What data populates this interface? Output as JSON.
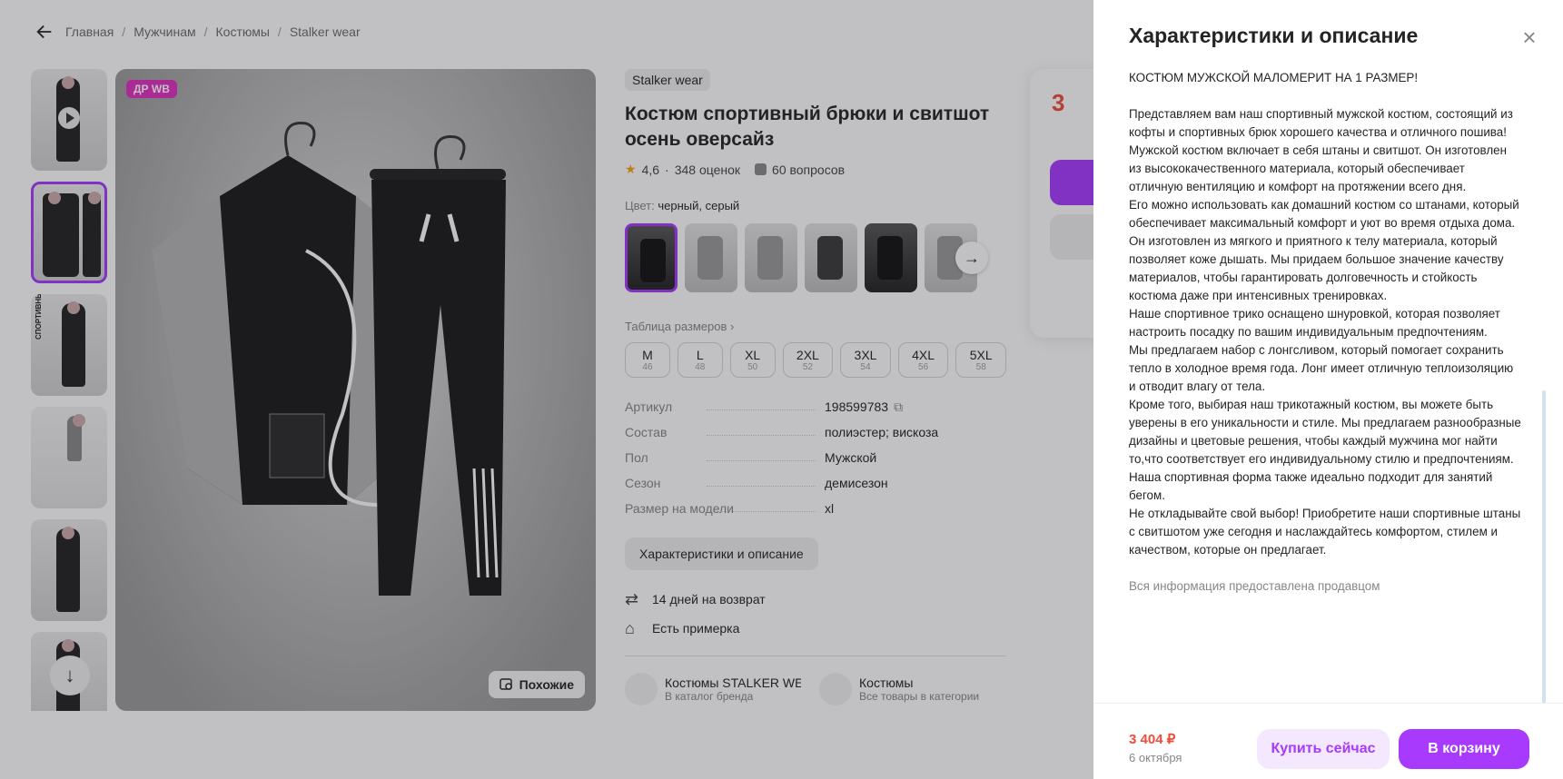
{
  "breadcrumb": {
    "items": [
      "Главная",
      "Мужчинам",
      "Костюмы",
      "Stalker wear"
    ]
  },
  "gallery": {
    "thumb_text": "СПОРТИВНЫЙ КОСТЮМ",
    "badge": "ДР WB",
    "similar_label": "Похожие"
  },
  "product": {
    "brand": "Stalker wear",
    "title": "Костюм спортивный брюки и свитшот осень оверсайз",
    "rating": "4,6",
    "reviews": "348 оценок",
    "questions": "60 вопросов",
    "color_label": "Цвет:",
    "color_value": "черный, серый",
    "size_table_link": "Таблица размеров",
    "sizes": [
      {
        "name": "M",
        "ru": "46"
      },
      {
        "name": "L",
        "ru": "48"
      },
      {
        "name": "XL",
        "ru": "50"
      },
      {
        "name": "2XL",
        "ru": "52"
      },
      {
        "name": "3XL",
        "ru": "54"
      },
      {
        "name": "4XL",
        "ru": "56"
      },
      {
        "name": "5XL",
        "ru": "58"
      }
    ],
    "specs": [
      {
        "k": "Артикул",
        "v": "198599783"
      },
      {
        "k": "Состав",
        "v": "полиэстер; вискоза"
      },
      {
        "k": "Пол",
        "v": "Мужской"
      },
      {
        "k": "Сезон",
        "v": "демисезон"
      },
      {
        "k": "Размер на модели",
        "v": "xl"
      }
    ],
    "desc_button": "Характеристики и описание",
    "return": "14 дней на возврат",
    "fitting": "Есть примерка",
    "card1_title": "Костюмы STALKER WEAR",
    "card1_sub": "В каталог бренда",
    "card2_title": "Костюмы",
    "card2_sub": "Все товары в категории"
  },
  "pricebox": {
    "price_partial": "3"
  },
  "panel": {
    "title": "Характеристики и описание",
    "description": "КОСТЮМ МУЖСКОЙ МАЛОМЕРИТ НА 1 РАЗМЕР!\n\nПредставляем вам наш спортивный мужской костюм, состоящий из кофты и спортивных брюк хорошего качества и отличного пошива!\nМужской костюм включает в себя штаны и свитшот. Он изготовлен из высококачественного материала, который обеспечивает отличную вентиляцию и комфорт на протяжении всего дня.\nЕго можно использовать как домашний костюм со штанами, который обеспечивает максимальный комфорт и уют во время отдыха дома. Он изготовлен из мягкого и приятного к телу материала, который позволяет коже дышать. Мы придаем большое значение качеству материалов, чтобы гарантировать долговечность и стойкость костюма даже при интенсивных тренировках.\nНаше спортивное трико оснащено шнуровкой, которая позволяет настроить посадку по вашим индивидуальным предпочтениям.\nМы предлагаем набор с лонгсливом, который помогает сохранить тепло в холодное время года. Лонг имеет отличную теплоизоляцию и отводит влагу от тела.\nКроме того, выбирая наш трикотажный костюм, вы можете быть уверены в его уникальности и стиле. Мы предлагаем разнообразные дизайны и цветовые решения, чтобы каждый мужчина мог найти то,что соответствует его индивидуальному стилю и предпочтениям.\nНаша спортивная форма также идеально подходит для занятий бегом.\nНе откладывайте свой выбор! Приобретите наши спортивные штаны с свитшотом уже сегодня и наслаждайтесь комфортом, стилем и качеством, которые он предлагает.",
    "note": "Вся информация предоставлена продавцом",
    "price": "3 404 ₽",
    "date": "6 октября",
    "buy_now": "Купить сейчас",
    "to_cart": "В корзину"
  },
  "colors": {
    "accent": "#a73afd",
    "price": "#f14b3b",
    "badge": "#e02fbf"
  }
}
